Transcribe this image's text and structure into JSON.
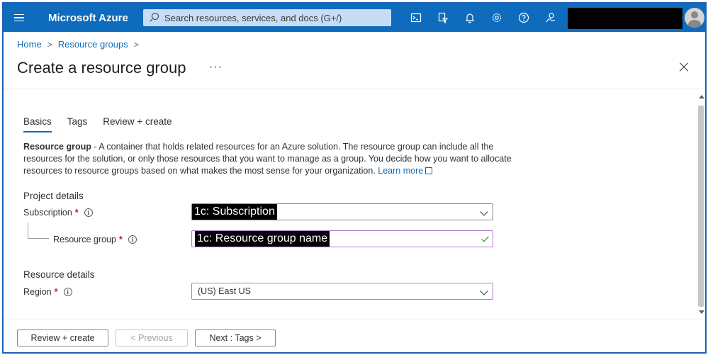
{
  "topbar": {
    "brand": "Microsoft Azure",
    "search_placeholder": "Search resources, services, and docs (G+/)",
    "icons": [
      "cloud-shell-icon",
      "directory-filter-icon",
      "notifications-icon",
      "settings-icon",
      "help-icon",
      "feedback-icon"
    ],
    "accent_color": "#0f6cbd"
  },
  "breadcrumb": {
    "items": [
      "Home",
      "Resource groups"
    ]
  },
  "page": {
    "title": "Create a resource group",
    "more": "···"
  },
  "tabs": [
    {
      "label": "Basics",
      "active": true
    },
    {
      "label": "Tags",
      "active": false
    },
    {
      "label": "Review + create",
      "active": false
    }
  ],
  "description": {
    "bold": "Resource group",
    "text": " - A container that holds related resources for an Azure solution. The resource group can include all the resources for the solution, or only those resources that you want to manage as a group. You decide how you want to allocate resources to resource groups based on what makes the most sense for your organization. ",
    "link": "Learn more"
  },
  "project_details": {
    "title": "Project details",
    "subscription_label": "Subscription",
    "subscription_value": "1c: Subscription",
    "resource_group_label": "Resource group",
    "resource_group_value": "1c: Resource group name",
    "required_mark": "*",
    "info_mark": "i"
  },
  "resource_details": {
    "title": "Resource details",
    "region_label": "Region",
    "region_value": "(US) East US"
  },
  "footer": {
    "review_create": "Review + create",
    "previous": "< Previous",
    "next": "Next : Tags >"
  }
}
